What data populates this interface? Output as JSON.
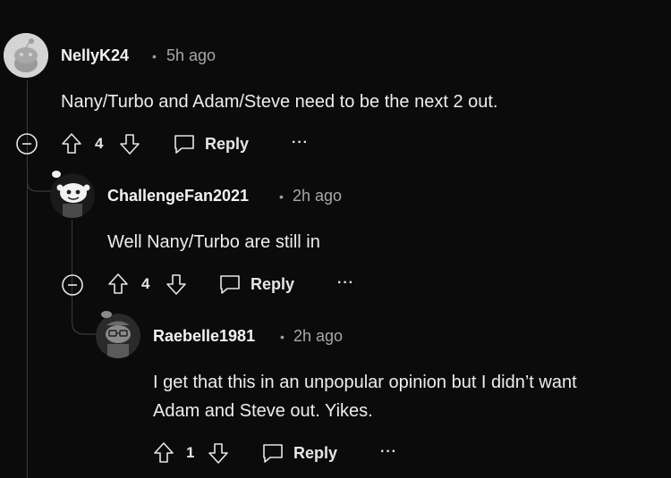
{
  "comments": [
    {
      "username": "NellyK24",
      "time": "5h ago",
      "body": "Nany/Turbo and Adam/Steve need to be the next 2 out.",
      "votes": "4",
      "reply_label": "Reply",
      "more_label": "···"
    },
    {
      "username": "ChallengeFan2021",
      "time": "2h ago",
      "body": "Well Nany/Turbo are still in",
      "votes": "4",
      "reply_label": "Reply",
      "more_label": "···"
    },
    {
      "username": "Raebelle1981",
      "time": "2h ago",
      "body_line1": "I get that this in an unpopular opinion but I didn’t want",
      "body_line2": "Adam and Steve out. Yikes.",
      "votes": "1",
      "reply_label": "Reply",
      "more_label": "···"
    }
  ],
  "separator": "•",
  "colors": {
    "background": "#0b0b0b",
    "text": "#e8e8e8",
    "muted": "#a8a8a8",
    "thread_line": "#3a3a3a"
  }
}
